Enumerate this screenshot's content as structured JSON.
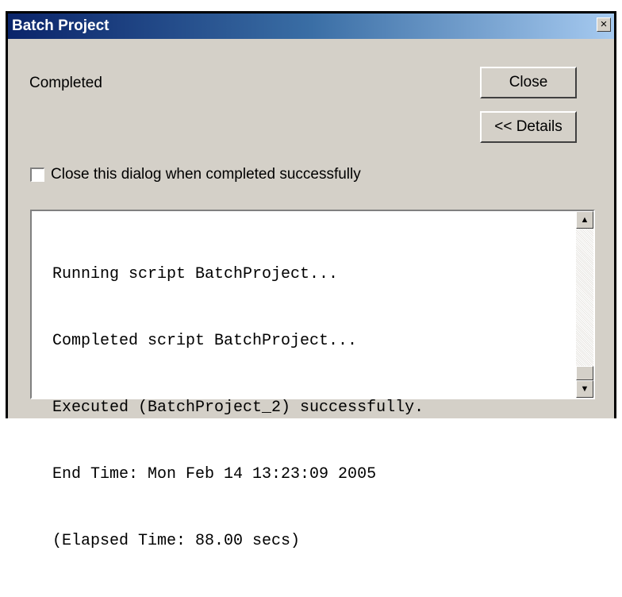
{
  "window": {
    "title": "Batch Project",
    "close_glyph": "×"
  },
  "status": {
    "text": "Completed"
  },
  "buttons": {
    "close_label": "Close",
    "details_label": "<< Details"
  },
  "options": {
    "close_on_success_label": "Close this dialog when completed successfully",
    "close_on_success_checked": false
  },
  "log": {
    "lines": [
      "Running script BatchProject...",
      "Completed script BatchProject...",
      "Executed (BatchProject_2) successfully.",
      "End Time: Mon Feb 14 13:23:09 2005",
      "(Elapsed Time: 88.00 secs)"
    ]
  },
  "scrollbar": {
    "up_glyph": "▲",
    "down_glyph": "▼"
  },
  "colors": {
    "titlebar_start": "#0a246a",
    "titlebar_end": "#a6caf0",
    "dialog_face": "#d4d0c8"
  }
}
